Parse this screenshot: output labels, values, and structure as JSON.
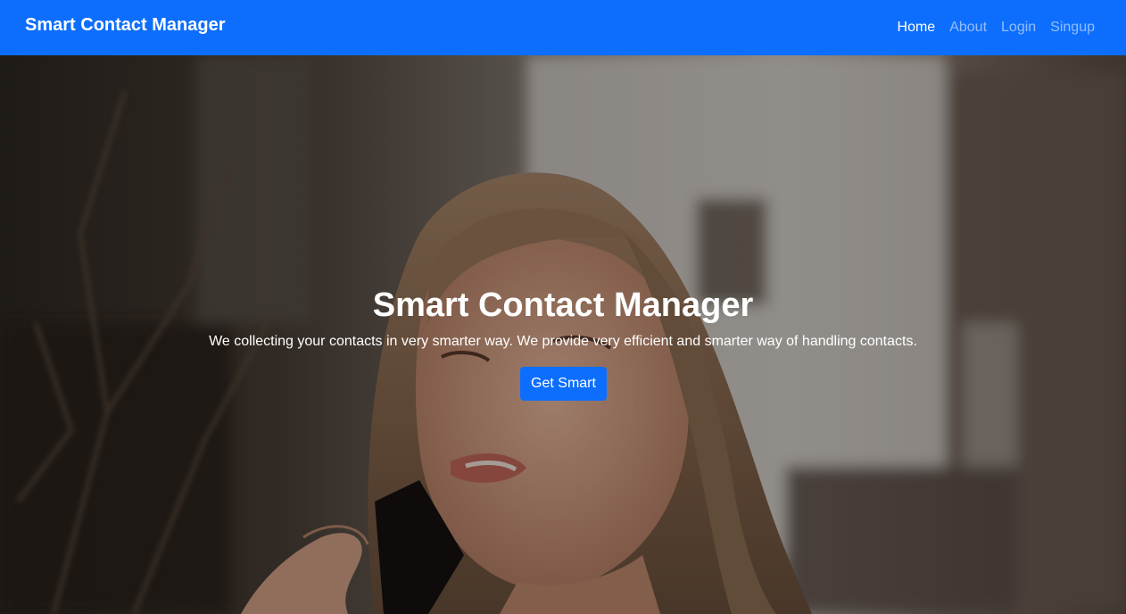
{
  "navbar": {
    "brand": "Smart Contact Manager",
    "links": [
      {
        "label": "Home",
        "active": true
      },
      {
        "label": "About",
        "active": false
      },
      {
        "label": "Login",
        "active": false
      },
      {
        "label": "Singup",
        "active": false
      }
    ]
  },
  "hero": {
    "title": "Smart Contact Manager",
    "subtitle": "We collecting your contacts in very smarter way. We provide very efficient and smarter way of handling contacts.",
    "button_label": "Get Smart"
  },
  "colors": {
    "primary": "#0d6efd",
    "text_light": "#ffffff"
  }
}
